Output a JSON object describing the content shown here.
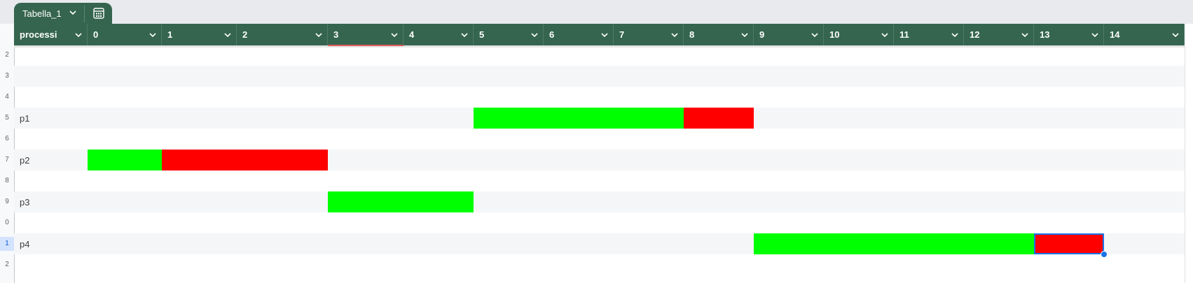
{
  "table": {
    "name": "Tabella_1"
  },
  "columns": [
    "processi",
    "0",
    "1",
    "2",
    "3",
    "4",
    "5",
    "6",
    "7",
    "8",
    "9",
    "10",
    "11",
    "12",
    "13",
    "14"
  ],
  "row_numbers": [
    "2",
    "3",
    "4",
    "5",
    "6",
    "7",
    "8",
    "9",
    "0",
    "1",
    "2"
  ],
  "processes": [
    {
      "label": "p1"
    },
    {
      "label": "p2"
    },
    {
      "label": "p3"
    },
    {
      "label": "p4"
    }
  ],
  "colors": {
    "header": "#35654f",
    "run": "#00ff00",
    "wait": "#ff0000",
    "band": "#f5f6f8",
    "selection": "#1a73e8"
  },
  "icons": {
    "dropdown": "chevron-down-icon",
    "calculator": "table-calculator-icon"
  },
  "schedule": [
    {
      "process": "p1",
      "segments": [
        {
          "start": 5,
          "end": 8,
          "state": "run"
        },
        {
          "start": 8,
          "end": 9,
          "state": "wait"
        }
      ]
    },
    {
      "process": "p2",
      "segments": [
        {
          "start": 0,
          "end": 1,
          "state": "run"
        },
        {
          "start": 1,
          "end": 3,
          "state": "wait"
        }
      ]
    },
    {
      "process": "p3",
      "segments": [
        {
          "start": 3,
          "end": 5,
          "state": "run"
        }
      ]
    },
    {
      "process": "p4",
      "segments": [
        {
          "start": 9,
          "end": 13,
          "state": "run"
        },
        {
          "start": 13,
          "end": 14,
          "state": "wait"
        }
      ]
    }
  ],
  "selected_cell": {
    "process": "p4",
    "column": "13"
  }
}
